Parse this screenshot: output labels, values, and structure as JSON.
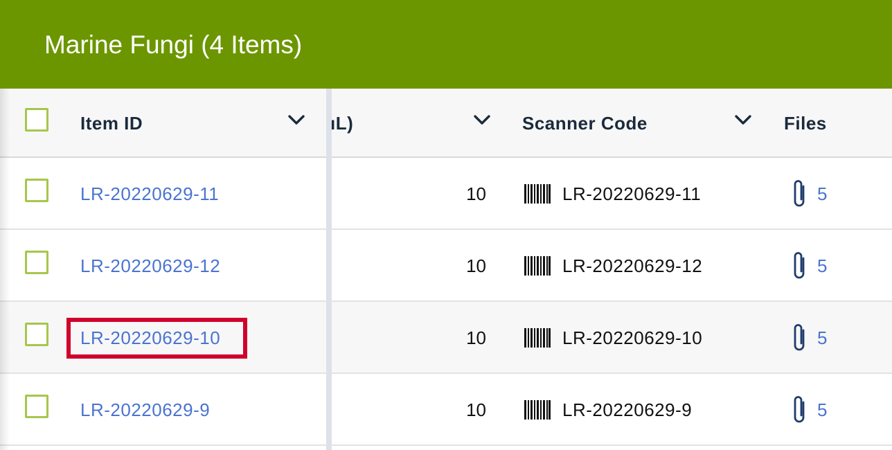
{
  "header": {
    "title": "Marine Fungi (4 Items)",
    "color": "#6c9600"
  },
  "columns": {
    "item_id": "Item ID",
    "volume_partial": "ıL)",
    "scanner_code": "Scanner Code",
    "files": "Files"
  },
  "icons": {
    "sort": "chevron-down-icon",
    "barcode": "barcode-icon",
    "files": "paperclip-icon"
  },
  "rows": [
    {
      "item_id": "LR-20220629-11",
      "volume": "10",
      "scanner_code": "LR-20220629-11",
      "files": "5"
    },
    {
      "item_id": "LR-20220629-12",
      "volume": "10",
      "scanner_code": "LR-20220629-12",
      "files": "5"
    },
    {
      "item_id": "LR-20220629-10",
      "volume": "10",
      "scanner_code": "LR-20220629-10",
      "files": "5"
    },
    {
      "item_id": "LR-20220629-9",
      "volume": "10",
      "scanner_code": "LR-20220629-9",
      "files": "5"
    }
  ],
  "colors": {
    "link": "#4a74d0",
    "checkbox_border": "#a6c64c",
    "highlight_border": "#d0022d"
  }
}
